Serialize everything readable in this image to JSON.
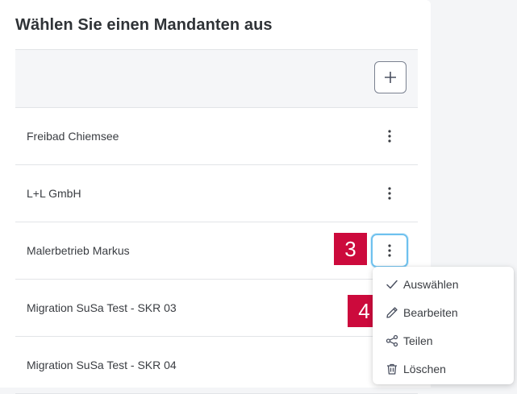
{
  "title": "Wählen Sie einen Mandanten aus",
  "header": {
    "add_button_label": "+"
  },
  "rows": [
    {
      "name": "Freibad Chiemsee"
    },
    {
      "name": "L+L GmbH"
    },
    {
      "name": "Malerbetrieb Markus"
    },
    {
      "name": "Migration SuSa Test - SKR 03"
    },
    {
      "name": "Migration SuSa Test - SKR 04"
    }
  ],
  "annotations": {
    "step3": "3",
    "step4": "4",
    "color": "#cc0a3c"
  },
  "menu": {
    "items": [
      {
        "label": "Auswählen",
        "icon": "check-icon"
      },
      {
        "label": "Bearbeiten",
        "icon": "pencil-icon"
      },
      {
        "label": "Teilen",
        "icon": "share-icon"
      },
      {
        "label": "Löschen",
        "icon": "trash-icon"
      }
    ]
  },
  "colors": {
    "accent_focus": "#6ec1ee",
    "badge": "#cc0a3c",
    "panel": "#ffffff",
    "background": "#f4f5f7"
  }
}
